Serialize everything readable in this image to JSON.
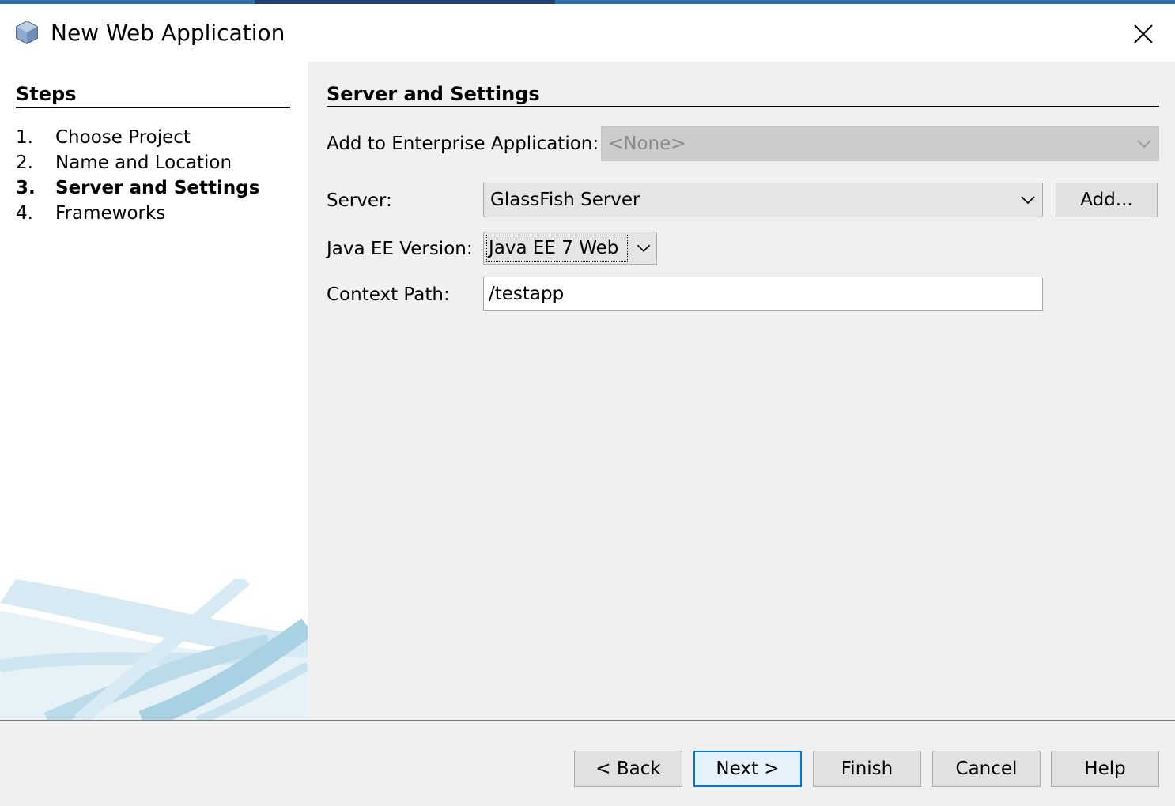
{
  "window": {
    "title": "New Web Application",
    "title_icon": "netbeans-cube-icon",
    "close_icon": "close-icon"
  },
  "steps": {
    "title": "Steps",
    "items": [
      {
        "num": "1.",
        "label": "Choose Project",
        "current": false
      },
      {
        "num": "2.",
        "label": "Name and Location",
        "current": false
      },
      {
        "num": "3.",
        "label": "Server and Settings",
        "current": true
      },
      {
        "num": "4.",
        "label": "Frameworks",
        "current": false
      }
    ]
  },
  "panel": {
    "title": "Server and Settings",
    "enterprise_label": "Add to Enterprise Application:",
    "enterprise_value": "<None>",
    "server_label": "Server:",
    "server_value": "GlassFish Server",
    "add_button": "Add...",
    "javaee_label": "Java EE Version:",
    "javaee_value": "Java EE 7 Web",
    "context_label": "Context Path:",
    "context_value": "/testapp"
  },
  "buttons": {
    "back": "< Back",
    "next": "Next >",
    "finish": "Finish",
    "cancel": "Cancel",
    "help": "Help"
  },
  "colors": {
    "panel_bg": "#f0f0f0",
    "default_button_border": "#0078d7",
    "disabled_combo_bg": "#cccccc"
  }
}
